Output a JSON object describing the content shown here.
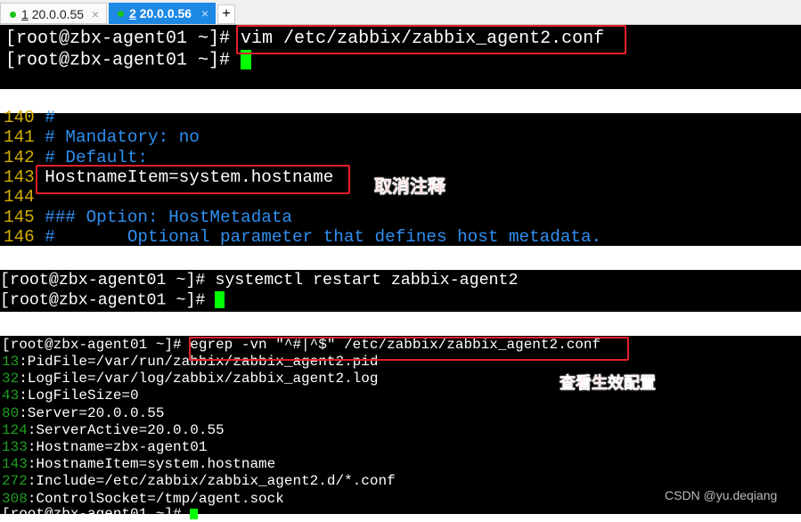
{
  "tabs": [
    {
      "num": "1",
      "label": "20.0.0.55",
      "close": "×"
    },
    {
      "num": "2",
      "label": "20.0.0.56",
      "close": "×"
    }
  ],
  "new_tab": "+",
  "panel1": {
    "lines": [
      {
        "prompt": "[root@zbx-agent01 ~]# ",
        "cmd": "vim /etc/zabbix/zabbix_agent2.conf"
      },
      {
        "prompt": "[root@zbx-agent01 ~]# ",
        "cmd": ""
      }
    ]
  },
  "panel2": {
    "lines": [
      {
        "n": "140",
        "t": " #"
      },
      {
        "n": "141",
        "t": " # Mandatory: no"
      },
      {
        "n": "142",
        "t": " # Default:"
      },
      {
        "n": "143",
        "t": " HostnameItem=system.hostname"
      },
      {
        "n": "144",
        "t": ""
      },
      {
        "n": "145",
        "t": " ### Option: HostMetadata"
      },
      {
        "n": "146",
        "t": " #       Optional parameter that defines host metadata."
      }
    ],
    "annotation": "取消注释"
  },
  "panel3": {
    "lines": [
      {
        "prompt": "[root@zbx-agent01 ~]# ",
        "cmd": "systemctl restart zabbix-agent2"
      },
      {
        "prompt": "[root@zbx-agent01 ~]# ",
        "cmd": ""
      }
    ]
  },
  "panel4": {
    "prompt": "[root@zbx-agent01 ~]# ",
    "cmd": "egrep -vn \"^#|^$\" /etc/zabbix/zabbix_agent2.conf",
    "lines": [
      {
        "n": "13",
        "t": ":PidFile=/var/run/zabbix/zabbix_agent2.pid"
      },
      {
        "n": "32",
        "t": ":LogFile=/var/log/zabbix/zabbix_agent2.log"
      },
      {
        "n": "43",
        "t": ":LogFileSize=0"
      },
      {
        "n": "80",
        "t": ":Server=20.0.0.55"
      },
      {
        "n": "124",
        "t": ":ServerActive=20.0.0.55"
      },
      {
        "n": "133",
        "t": ":Hostname=zbx-agent01"
      },
      {
        "n": "143",
        "t": ":HostnameItem=system.hostname"
      },
      {
        "n": "272",
        "t": ":Include=/etc/zabbix/zabbix_agent2.d/*.conf"
      },
      {
        "n": "308",
        "t": ":ControlSocket=/tmp/agent.sock"
      }
    ],
    "last_prompt": "[root@zbx-agent01 ~]# ",
    "annotation": "查看生效配置"
  },
  "watermark": "CSDN @yu.deqiang"
}
